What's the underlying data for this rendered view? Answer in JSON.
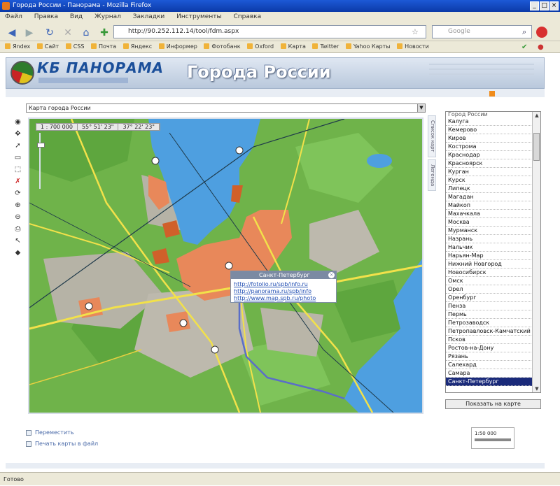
{
  "window": {
    "title": "Города России - Панорама - Mozilla Firefox"
  },
  "menu": [
    "Файл",
    "Правка",
    "Вид",
    "Журнал",
    "Закладки",
    "Инструменты",
    "Справка"
  ],
  "nav": {
    "url": "http://90.252.112.14/tool/fdm.aspx",
    "search_placeholder": "Google"
  },
  "bookmarks": [
    "Яndex",
    "Сайт",
    "CSS",
    "Почта",
    "Яндекс",
    "Информер",
    "Фотобанк",
    "Oxford",
    "Карта",
    "Twitter",
    "Yahoo Карты",
    "Новости"
  ],
  "header": {
    "logo": "КБ ПАНОРАМА",
    "title": "Города России"
  },
  "map": {
    "select_value": "Карта города России",
    "coords": [
      "1 : 700 000",
      "55° 51' 23\"",
      "37° 22' 23\""
    ],
    "popup": {
      "title": "Санкт-Петербург",
      "links": [
        "http://fotolio.ru/spb/info.ru",
        "http://panorama.ru/spb/info",
        "http://www.map.spb.ru/photo"
      ]
    },
    "side_tabs": [
      "Список карт",
      "Легенда"
    ]
  },
  "city_list": {
    "header": "Город России",
    "items": [
      "Калуга",
      "Кемерово",
      "Киров",
      "Кострома",
      "Краснодар",
      "Красноярск",
      "Курган",
      "Курск",
      "Липецк",
      "Магадан",
      "Майкоп",
      "Махачкала",
      "Москва",
      "Мурманск",
      "Назрань",
      "Нальчик",
      "Нарьян-Мар",
      "Нижний Новгород",
      "Новосибирск",
      "Омск",
      "Орел",
      "Оренбург",
      "Пенза",
      "Пермь",
      "Петрозаводск",
      "Петропавловск-Камчатский",
      "Псков",
      "Ростов-на-Дону",
      "Рязань",
      "Салехард",
      "Самара",
      "Санкт-Петербург"
    ],
    "selected": "Санкт-Петербург",
    "show_button": "Показать на карте"
  },
  "options": {
    "option1": "Переместить",
    "option2": "Печать карты в файл"
  },
  "scale_value": "1:50 000",
  "status": "Готово",
  "colors": {
    "land": "#6fb34a",
    "water": "#4e9fe0",
    "urban": "#e8885a",
    "road": "#f2e14a"
  }
}
